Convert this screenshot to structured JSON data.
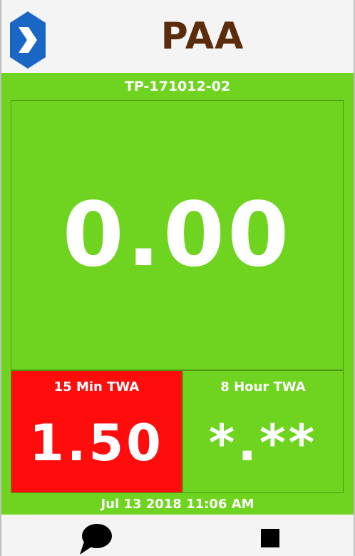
{
  "header": {
    "title": "PAA",
    "logo_icon": "hexagon-chevron-logo",
    "logo_color": "#1a66c4"
  },
  "device": {
    "id": "TP-171012-02"
  },
  "reading": {
    "value": "0.00",
    "color": "#6fd41f"
  },
  "twa_15min": {
    "label": "15 Min TWA",
    "value": "1.50",
    "color": "#ff0d0d"
  },
  "twa_8hour": {
    "label": "8 Hour TWA",
    "value": "*.**",
    "color": "#6fd41f"
  },
  "status": {
    "datetime": "Jul 13 2018 11:06 AM"
  },
  "bottom_bar": {
    "left_icon": "chat-bubble-icon",
    "right_icon": "stop-icon"
  },
  "title_color": "#5a2c0a"
}
